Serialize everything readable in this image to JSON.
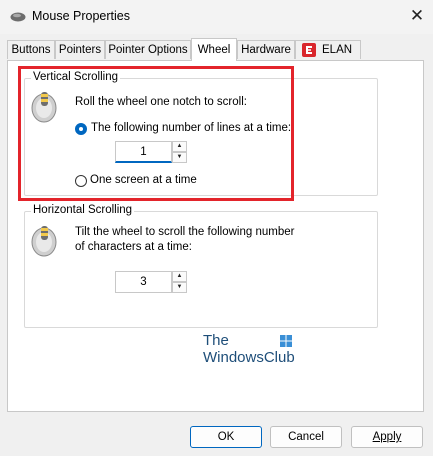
{
  "window": {
    "title": "Mouse Properties",
    "close_glyph": "✕"
  },
  "tabs": [
    {
      "label": "Buttons"
    },
    {
      "label": "Pointers"
    },
    {
      "label": "Pointer Options"
    },
    {
      "label": "Wheel"
    },
    {
      "label": "Hardware"
    },
    {
      "label": "ELAN"
    }
  ],
  "active_tab": "Wheel",
  "vertical": {
    "legend": "Vertical Scrolling",
    "description": "Roll the wheel one notch to scroll:",
    "option_lines": "The following number of lines at a time:",
    "option_screen": "One screen at a time",
    "selected": "lines",
    "lines_value": "1"
  },
  "horizontal": {
    "legend": "Horizontal Scrolling",
    "description_line1": "Tilt the wheel to scroll the following number",
    "description_line2": "of characters at a time:",
    "chars_value": "3"
  },
  "watermark": {
    "line1": "The",
    "line2": "WindowsClub"
  },
  "buttons": {
    "ok": "OK",
    "cancel": "Cancel",
    "apply": "Apply"
  },
  "colors": {
    "accent": "#0067c0",
    "highlight_box": "#e3242b",
    "elan_red": "#d9262c"
  },
  "icons": [
    "mouse-icon",
    "close-icon",
    "wheel-icon",
    "spin-up-icon",
    "spin-down-icon",
    "elan-logo-icon"
  ]
}
